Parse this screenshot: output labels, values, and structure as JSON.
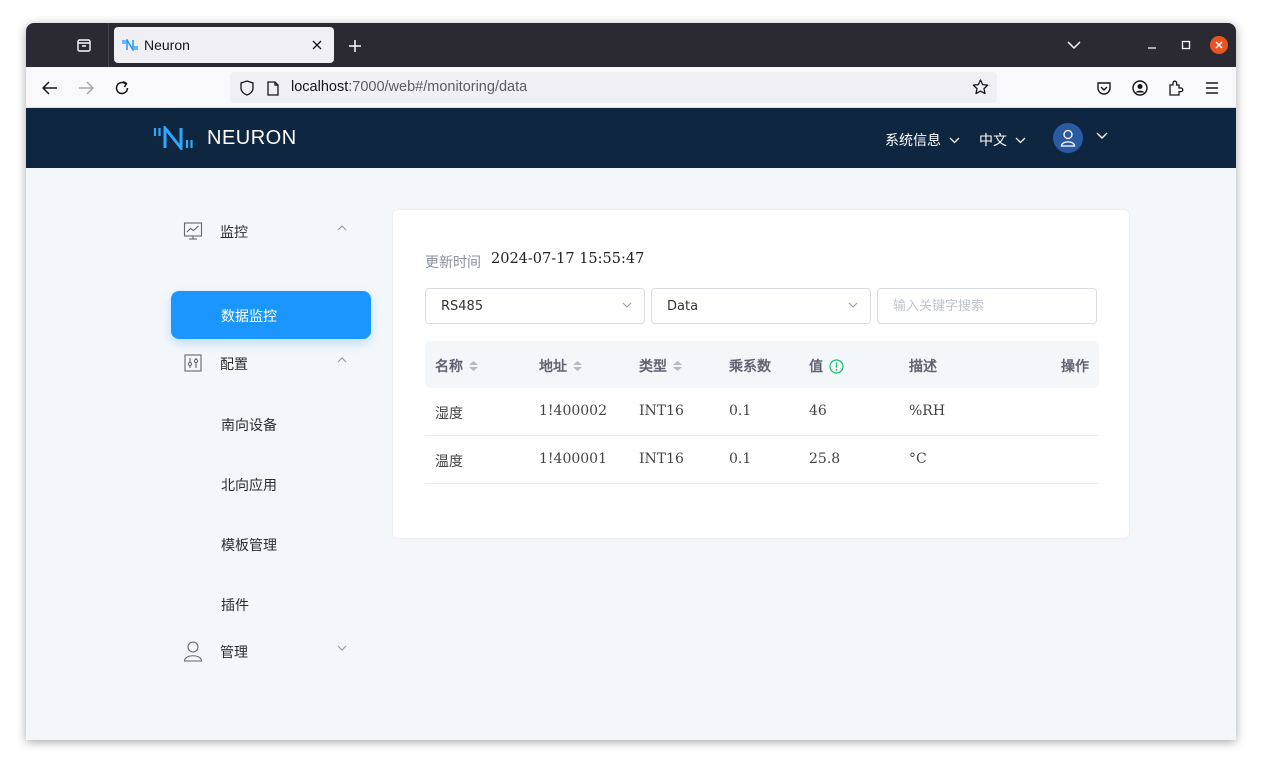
{
  "browser": {
    "tab_title": "Neuron",
    "url_host": "localhost",
    "url_rest": ":7000/web#/monitoring/data"
  },
  "header": {
    "logo_text": "NEURON",
    "system_info": "系统信息",
    "language": "中文"
  },
  "sidebar": {
    "groups": [
      {
        "label": "监控",
        "icon": "monitor-chart-icon",
        "expanded": true
      },
      {
        "label": "配置",
        "icon": "config-sliders-icon",
        "expanded": true
      },
      {
        "label": "管理",
        "icon": "user-icon",
        "expanded": false
      }
    ],
    "monitor_items": [
      {
        "label": "数据监控",
        "active": true
      }
    ],
    "config_items": [
      {
        "label": "南向设备"
      },
      {
        "label": "北向应用"
      },
      {
        "label": "模板管理"
      },
      {
        "label": "插件"
      }
    ]
  },
  "main": {
    "update_label": "更新时间",
    "update_value": "2024-07-17 15:55:47",
    "node_select": "RS485",
    "group_select": "Data",
    "search_placeholder": "输入关键字搜索",
    "columns": [
      "名称",
      "地址",
      "类型",
      "乘系数",
      "值",
      "描述",
      "操作"
    ],
    "rows": [
      {
        "name": "湿度",
        "address": "1!400002",
        "type": "INT16",
        "multiplier": "0.1",
        "value": "46",
        "desc": "%RH"
      },
      {
        "name": "温度",
        "address": "1!400001",
        "type": "INT16",
        "multiplier": "0.1",
        "value": "25.8",
        "desc": "°C"
      }
    ]
  },
  "colors": {
    "header_bg": "#0f2640",
    "accent": "#1b96ff",
    "info_icon": "#19be6b"
  }
}
